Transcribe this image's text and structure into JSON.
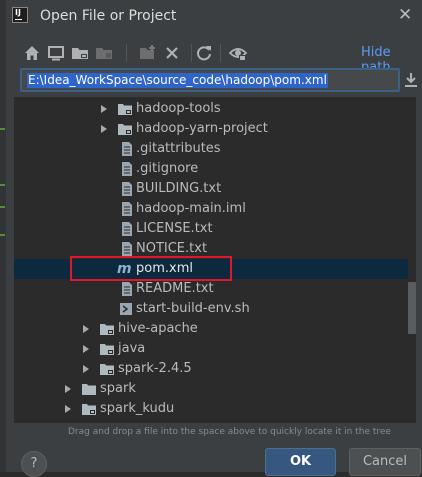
{
  "window": {
    "title": "Open File or Project",
    "app_icon_text": "IJ"
  },
  "toolbar": {
    "icons": [
      "home-icon",
      "desktop-icon",
      "project-folder-icon",
      "module-folder-icon",
      "new-folder-icon",
      "delete-icon",
      "refresh-icon",
      "show-hidden-icon"
    ],
    "hide_path_label": "Hide path"
  },
  "path": {
    "value": "E:\\Idea_WorkSpace\\source_code\\hadoop\\pom.xml"
  },
  "tree": {
    "items": [
      {
        "label": "hadoop-tools",
        "type": "folder",
        "expandable": true,
        "indent": 2
      },
      {
        "label": "hadoop-yarn-project",
        "type": "folder",
        "expandable": true,
        "indent": 2
      },
      {
        "label": ".gitattributes",
        "type": "file",
        "expandable": false,
        "indent": 2
      },
      {
        "label": ".gitignore",
        "type": "file",
        "expandable": false,
        "indent": 2
      },
      {
        "label": "BUILDING.txt",
        "type": "file",
        "expandable": false,
        "indent": 2
      },
      {
        "label": "hadoop-main.iml",
        "type": "file",
        "expandable": false,
        "indent": 2
      },
      {
        "label": "LICENSE.txt",
        "type": "file",
        "expandable": false,
        "indent": 2
      },
      {
        "label": "NOTICE.txt",
        "type": "file",
        "expandable": false,
        "indent": 2
      },
      {
        "label": "pom.xml",
        "type": "maven",
        "expandable": false,
        "indent": 2,
        "selected": true
      },
      {
        "label": "README.txt",
        "type": "file",
        "expandable": false,
        "indent": 2
      },
      {
        "label": "start-build-env.sh",
        "type": "script",
        "expandable": false,
        "indent": 2
      },
      {
        "label": "hive-apache",
        "type": "folder",
        "expandable": true,
        "indent": 1
      },
      {
        "label": "java",
        "type": "folder",
        "expandable": true,
        "indent": 1
      },
      {
        "label": "spark-2.4.5",
        "type": "folder",
        "expandable": true,
        "indent": 1
      },
      {
        "label": "spark",
        "type": "folder",
        "expandable": true,
        "indent": 0
      },
      {
        "label": "spark_kudu",
        "type": "folder",
        "expandable": true,
        "indent": 0
      }
    ]
  },
  "hint": "Drag and drop a file into the space above to quickly locate it in the tree",
  "buttons": {
    "help": "?",
    "ok": "OK",
    "cancel": "Cancel"
  },
  "colors": {
    "accent": "#2f65ca",
    "selection": "#0d293e",
    "highlight_box": "#e0162b",
    "link": "#589df6"
  }
}
